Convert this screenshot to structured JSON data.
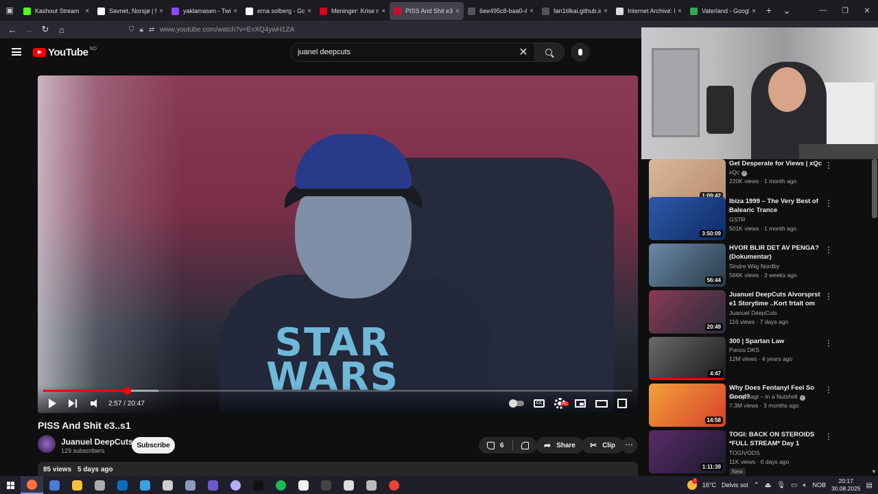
{
  "browser": {
    "tabs": [
      {
        "label": "Kashout Stream",
        "color": "#53fc18",
        "active": false
      },
      {
        "label": "Savnet, Norsjø | My",
        "color": "#ffffff",
        "active": false
      },
      {
        "label": "yaklamasen - Twitch",
        "color": "#9146ff",
        "active": false
      },
      {
        "label": "erna solberg - Goog",
        "color": "#ffffff",
        "active": false
      },
      {
        "label": "Meninger: Krise me",
        "color": "#e0001a",
        "active": false
      },
      {
        "label": "PISS And Shit e3..",
        "color": "#c8102e",
        "active": true
      },
      {
        "label": "6ee495c8-baa0-4846-b",
        "color": "#555555",
        "active": false
      },
      {
        "label": "fan1tilkai.github.io/sou",
        "color": "#555555",
        "active": false
      },
      {
        "label": "Internet Archive: Di",
        "color": "#dddddd",
        "active": false
      },
      {
        "label": "Vaterland - Google",
        "color": "#34a853",
        "active": false
      }
    ],
    "url": "www.youtube.com/watch?v=EvXQ4ywH1ZA",
    "new_tab": "+",
    "tab_list": "⌄",
    "close_glyph": "×"
  },
  "youtube": {
    "logo_text": "YouTube",
    "region": "NO",
    "search": {
      "value": "juanel deepcuts",
      "placeholder": "Search"
    }
  },
  "player": {
    "time_current": "2:57",
    "time_total": "20:47",
    "time_display": "2:57 / 20:47",
    "progress_fraction": 0.142,
    "buffer_fraction": 0.195,
    "shirt_text_line1": "STAR",
    "shirt_text_line2": "WARS",
    "hd_badge": "HD",
    "cc_label": "CC"
  },
  "video": {
    "title": "PISS And Shit e3..s1",
    "channel": "Juanuel DeepCuts",
    "subscribers": "129 subscribers",
    "subscribe_label": "Subscribe",
    "likes": "6",
    "share_label": "Share",
    "clip_label": "Clip",
    "more_glyph": "⋯",
    "views": "85 views",
    "posted": "5 days ago"
  },
  "recommendations": [
    {
      "title": "Get Desperate for Views | xQc ...",
      "channel": "xQc",
      "verified": true,
      "views": "220K views",
      "age": "1 month ago",
      "duration": "1:09:42",
      "thumb_colors": [
        "#d9b89a",
        "#b88c70"
      ],
      "badge": ""
    },
    {
      "title": "Ibiza 1999 – The Very Best of Balearic Trance",
      "channel": "GSTR",
      "verified": false,
      "views": "501K views",
      "age": "1 month ago",
      "duration": "3:50:09",
      "thumb_colors": [
        "#2f5aa8",
        "#0d2a66"
      ],
      "badge": ""
    },
    {
      "title": "HVOR BLIR DET AV PENGA? (Dokumentar)",
      "channel": "Sindre Wiig Nordby",
      "verified": false,
      "views": "566K views",
      "age": "3 weeks ago",
      "duration": "56:44",
      "thumb_colors": [
        "#6a8aa8",
        "#2a3a4a"
      ],
      "badge": ""
    },
    {
      "title": "Juanuel DeepCuts Alvorsprst e1 Storytime ..Kort frtalt om Min ...",
      "channel": "Juanuel DeepCuts",
      "verified": false,
      "views": "116 views",
      "age": "7 days ago",
      "duration": "20:49",
      "thumb_colors": [
        "#8a3a55",
        "#2a2d3a"
      ],
      "badge": ""
    },
    {
      "title": "300 | Spartan Law",
      "channel": "Panos DKS",
      "verified": false,
      "views": "12M views",
      "age": "4 years ago",
      "duration": "4:47",
      "thumb_colors": [
        "#6a6a6a",
        "#1a1a1a"
      ],
      "badge": ""
    },
    {
      "title": "Why Does Fentanyl Feel So Good?",
      "channel": "Kurzgesagt – In a Nutshell",
      "verified": true,
      "views": "7.3M views",
      "age": "3 months ago",
      "duration": "14:58",
      "thumb_colors": [
        "#f2a23a",
        "#d8402a"
      ],
      "badge": ""
    },
    {
      "title": "TOGI: BACK ON STEROIDS *FULL STREAM* Day 1",
      "channel": "TOGIVODS",
      "verified": false,
      "views": "11K views",
      "age": "6 days ago",
      "duration": "1:11:39",
      "thumb_colors": [
        "#5a2a6a",
        "#1a1a2a"
      ],
      "badge": "New"
    }
  ],
  "taskbar": {
    "apps": [
      {
        "name": "firefox",
        "color": "#ff7139",
        "active": true
      },
      {
        "name": "chrome-dev",
        "color": "#4a7bd8",
        "active": false
      },
      {
        "name": "file-explorer",
        "color": "#f3c13a",
        "active": false
      },
      {
        "name": "app-grey",
        "color": "#aaaaaa",
        "active": false
      },
      {
        "name": "outlook",
        "color": "#0f6cbd",
        "active": false
      },
      {
        "name": "monitor",
        "color": "#3aa0e0",
        "active": false
      },
      {
        "name": "app-4",
        "color": "#cfcfcf",
        "active": false
      },
      {
        "name": "camera",
        "color": "#8a9abd",
        "active": false
      },
      {
        "name": "app-purple",
        "color": "#6a5acd",
        "active": false
      },
      {
        "name": "app-circle",
        "color": "#b0b0ff",
        "active": false
      },
      {
        "name": "tiktok",
        "color": "#111111",
        "active": false
      },
      {
        "name": "spotify",
        "color": "#1db954",
        "active": false
      },
      {
        "name": "itunes",
        "color": "#f0f0f0",
        "active": false
      },
      {
        "name": "app-dark",
        "color": "#444444",
        "active": false
      },
      {
        "name": "app-light",
        "color": "#dddddd",
        "active": false
      },
      {
        "name": "app-light-2",
        "color": "#bbbbbb",
        "active": false
      },
      {
        "name": "chrome",
        "color": "#ea4335",
        "active": false
      }
    ],
    "weather_temp": "16°C",
    "weather_desc": "Delvis sol",
    "weather_badge": "2",
    "language": "NOB",
    "time": "20:17",
    "date": "30.08.2025"
  }
}
